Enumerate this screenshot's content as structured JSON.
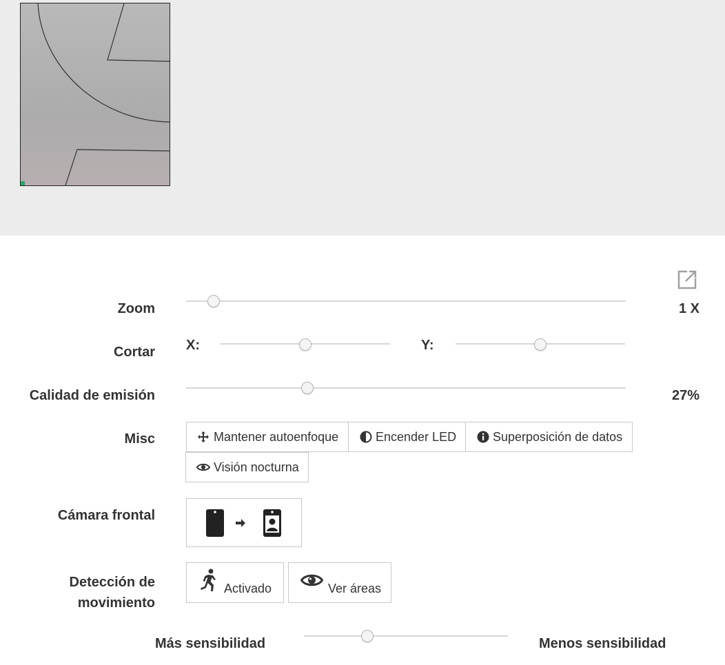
{
  "preview": {
    "alt": "camera preview"
  },
  "controls": {
    "zoom": {
      "label": "Zoom",
      "value_text": "1 X",
      "level": 0.05
    },
    "crop": {
      "label": "Cortar",
      "x_label": "X:",
      "y_label": "Y:",
      "x_level": 0.5,
      "y_level": 0.5
    },
    "quality": {
      "label": "Calidad de emisión",
      "value_text": "27%",
      "level": 0.27
    },
    "misc": {
      "label": "Misc",
      "buttons": [
        {
          "label": "Mantener autoenfoque",
          "icon": "move-icon"
        },
        {
          "label": "Encender LED",
          "icon": "contrast-icon"
        },
        {
          "label": "Superposición de datos",
          "icon": "info-icon"
        },
        {
          "label": "Visión nocturna",
          "icon": "eye-icon"
        }
      ]
    },
    "front_camera": {
      "label": "Cámara frontal",
      "icon": "switch-camera-icon"
    },
    "motion": {
      "label_line1": "Detección de",
      "label_line2": "movimiento",
      "activate_label": "Activado",
      "activate_icon": "running-person-icon",
      "view_label": "Ver áreas",
      "view_icon": "eye-icon"
    },
    "sensitivity": {
      "more_label": "Más sensibilidad",
      "less_label": "Menos sensibilidad",
      "level": 0.3
    }
  }
}
